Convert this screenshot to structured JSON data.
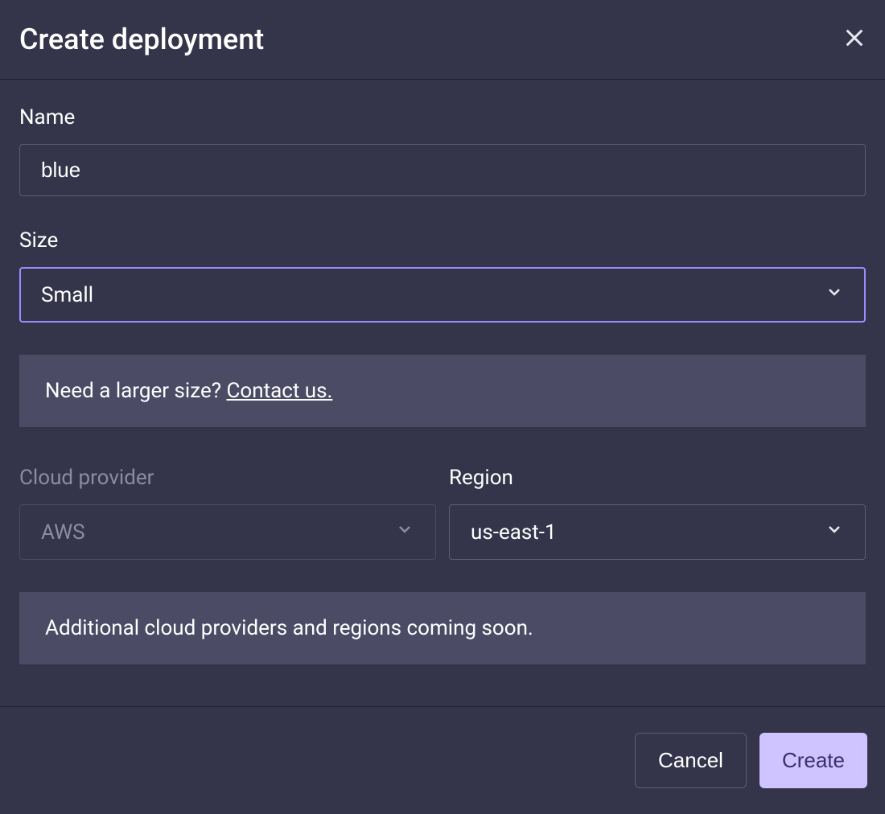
{
  "header": {
    "title": "Create deployment"
  },
  "form": {
    "name": {
      "label": "Name",
      "value": "blue"
    },
    "size": {
      "label": "Size",
      "value": "Small"
    },
    "size_banner": {
      "text": "Need a larger size? ",
      "link": "Contact us."
    },
    "cloud_provider": {
      "label": "Cloud provider",
      "value": "AWS"
    },
    "region": {
      "label": "Region",
      "value": "us-east-1"
    },
    "provider_banner": {
      "text": "Additional cloud providers and regions coming soon."
    }
  },
  "footer": {
    "cancel": "Cancel",
    "create": "Create"
  }
}
